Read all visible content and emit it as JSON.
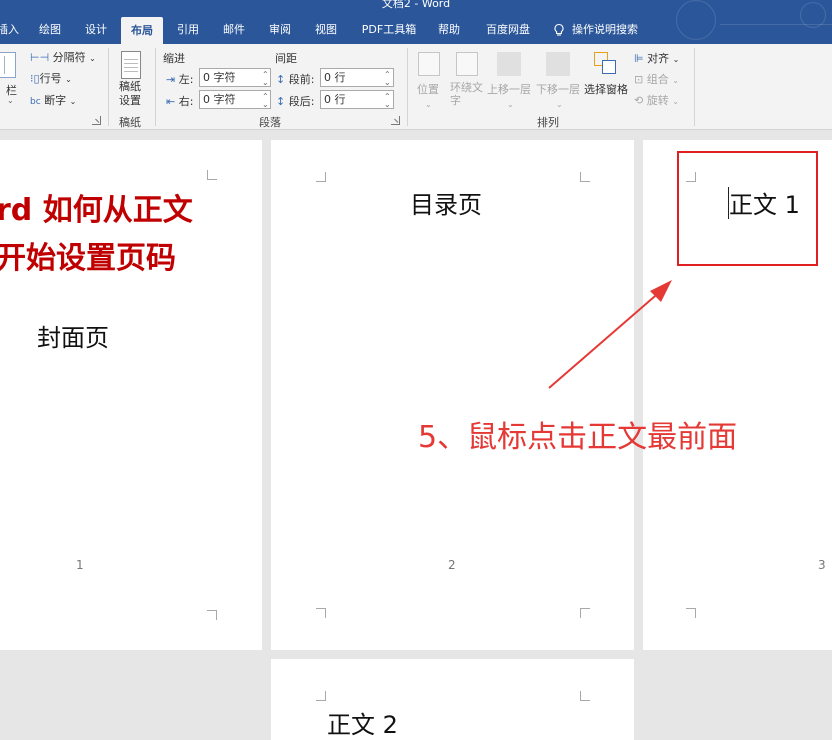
{
  "window": {
    "title": "文档2 - Word"
  },
  "tabs": [
    {
      "label": "插入",
      "active": false
    },
    {
      "label": "绘图",
      "active": false
    },
    {
      "label": "设计",
      "active": false
    },
    {
      "label": "布局",
      "active": true
    },
    {
      "label": "引用",
      "active": false
    },
    {
      "label": "邮件",
      "active": false
    },
    {
      "label": "审阅",
      "active": false
    },
    {
      "label": "视图",
      "active": false
    },
    {
      "label": "PDF工具箱",
      "active": false
    },
    {
      "label": "帮助",
      "active": false
    },
    {
      "label": "百度网盘",
      "active": false
    }
  ],
  "tell_me": {
    "label": "操作说明搜索",
    "icon": "lightbulb-icon"
  },
  "ribbon": {
    "page_setup": {
      "columns_label": "栏",
      "breaks_label": "分隔符",
      "line_numbers_label": "行号",
      "hyphenation_label": "断字"
    },
    "draft_paper": {
      "button_label": "稿纸\n设置",
      "group_label": "稿纸"
    },
    "paragraph": {
      "indent_header": "缩进",
      "spacing_header": "间距",
      "left_label": "左:",
      "right_label": "右:",
      "before_label": "段前:",
      "after_label": "段后:",
      "left_value": "0 字符",
      "right_value": "0 字符",
      "before_value": "0 行",
      "after_value": "0 行",
      "group_label": "段落"
    },
    "arrange": {
      "position_label": "位置",
      "wrap_text_label": "环绕文字",
      "bring_forward_label": "上移一层",
      "send_backward_label": "下移一层",
      "selection_pane_label": "选择窗格",
      "align_label": "对齐",
      "group_label": "组合",
      "rotate_label": "旋转",
      "group_name": "排列"
    }
  },
  "pages": [
    {
      "heading_line1": "rd 如何从正文",
      "heading_line2": "开始设置页码",
      "body_text": "封面页",
      "page_number": "1"
    },
    {
      "body_text": "目录页",
      "page_number": "2"
    },
    {
      "body_text": "正文 1",
      "page_number": "3"
    },
    {
      "body_text": "正文 2"
    }
  ],
  "annotation": {
    "text": "5、鼠标点击正文最前面",
    "color": "#e53935"
  },
  "colors": {
    "title_bar": "#2b579a",
    "ribbon": "#f3f3f3",
    "workspace": "#e6e6e6",
    "heading_red": "#c00000",
    "highlight_box": "#e02020"
  }
}
